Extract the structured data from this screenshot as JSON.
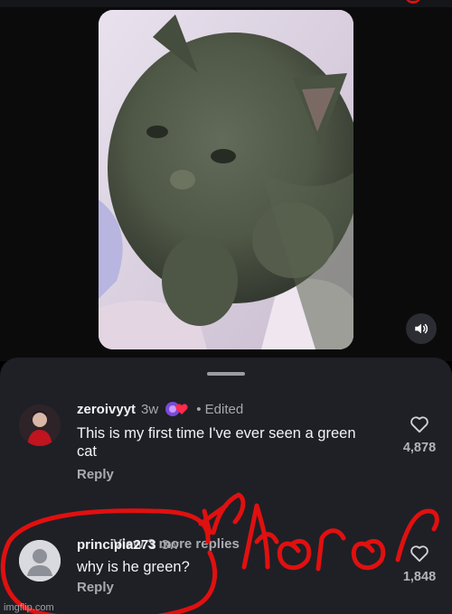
{
  "media": {
    "subject_icon": "kitten-photo",
    "sound_icon": "speaker-icon"
  },
  "comments": [
    {
      "username": "zeroivyyt",
      "time": "3w",
      "edited": "• Edited",
      "text": "This is my first time I've ever seen a green cat",
      "reply": "Reply",
      "likes": "4,878"
    },
    {
      "username": "principia273",
      "time": "3w",
      "text": "why is he green?",
      "reply": "Reply",
      "likes": "1,848"
    }
  ],
  "view_more": "View 3 more replies",
  "watermark": "imgflip.com",
  "colors": {
    "sheet_bg": "#1e2026",
    "annotation_red": "#e01010"
  }
}
